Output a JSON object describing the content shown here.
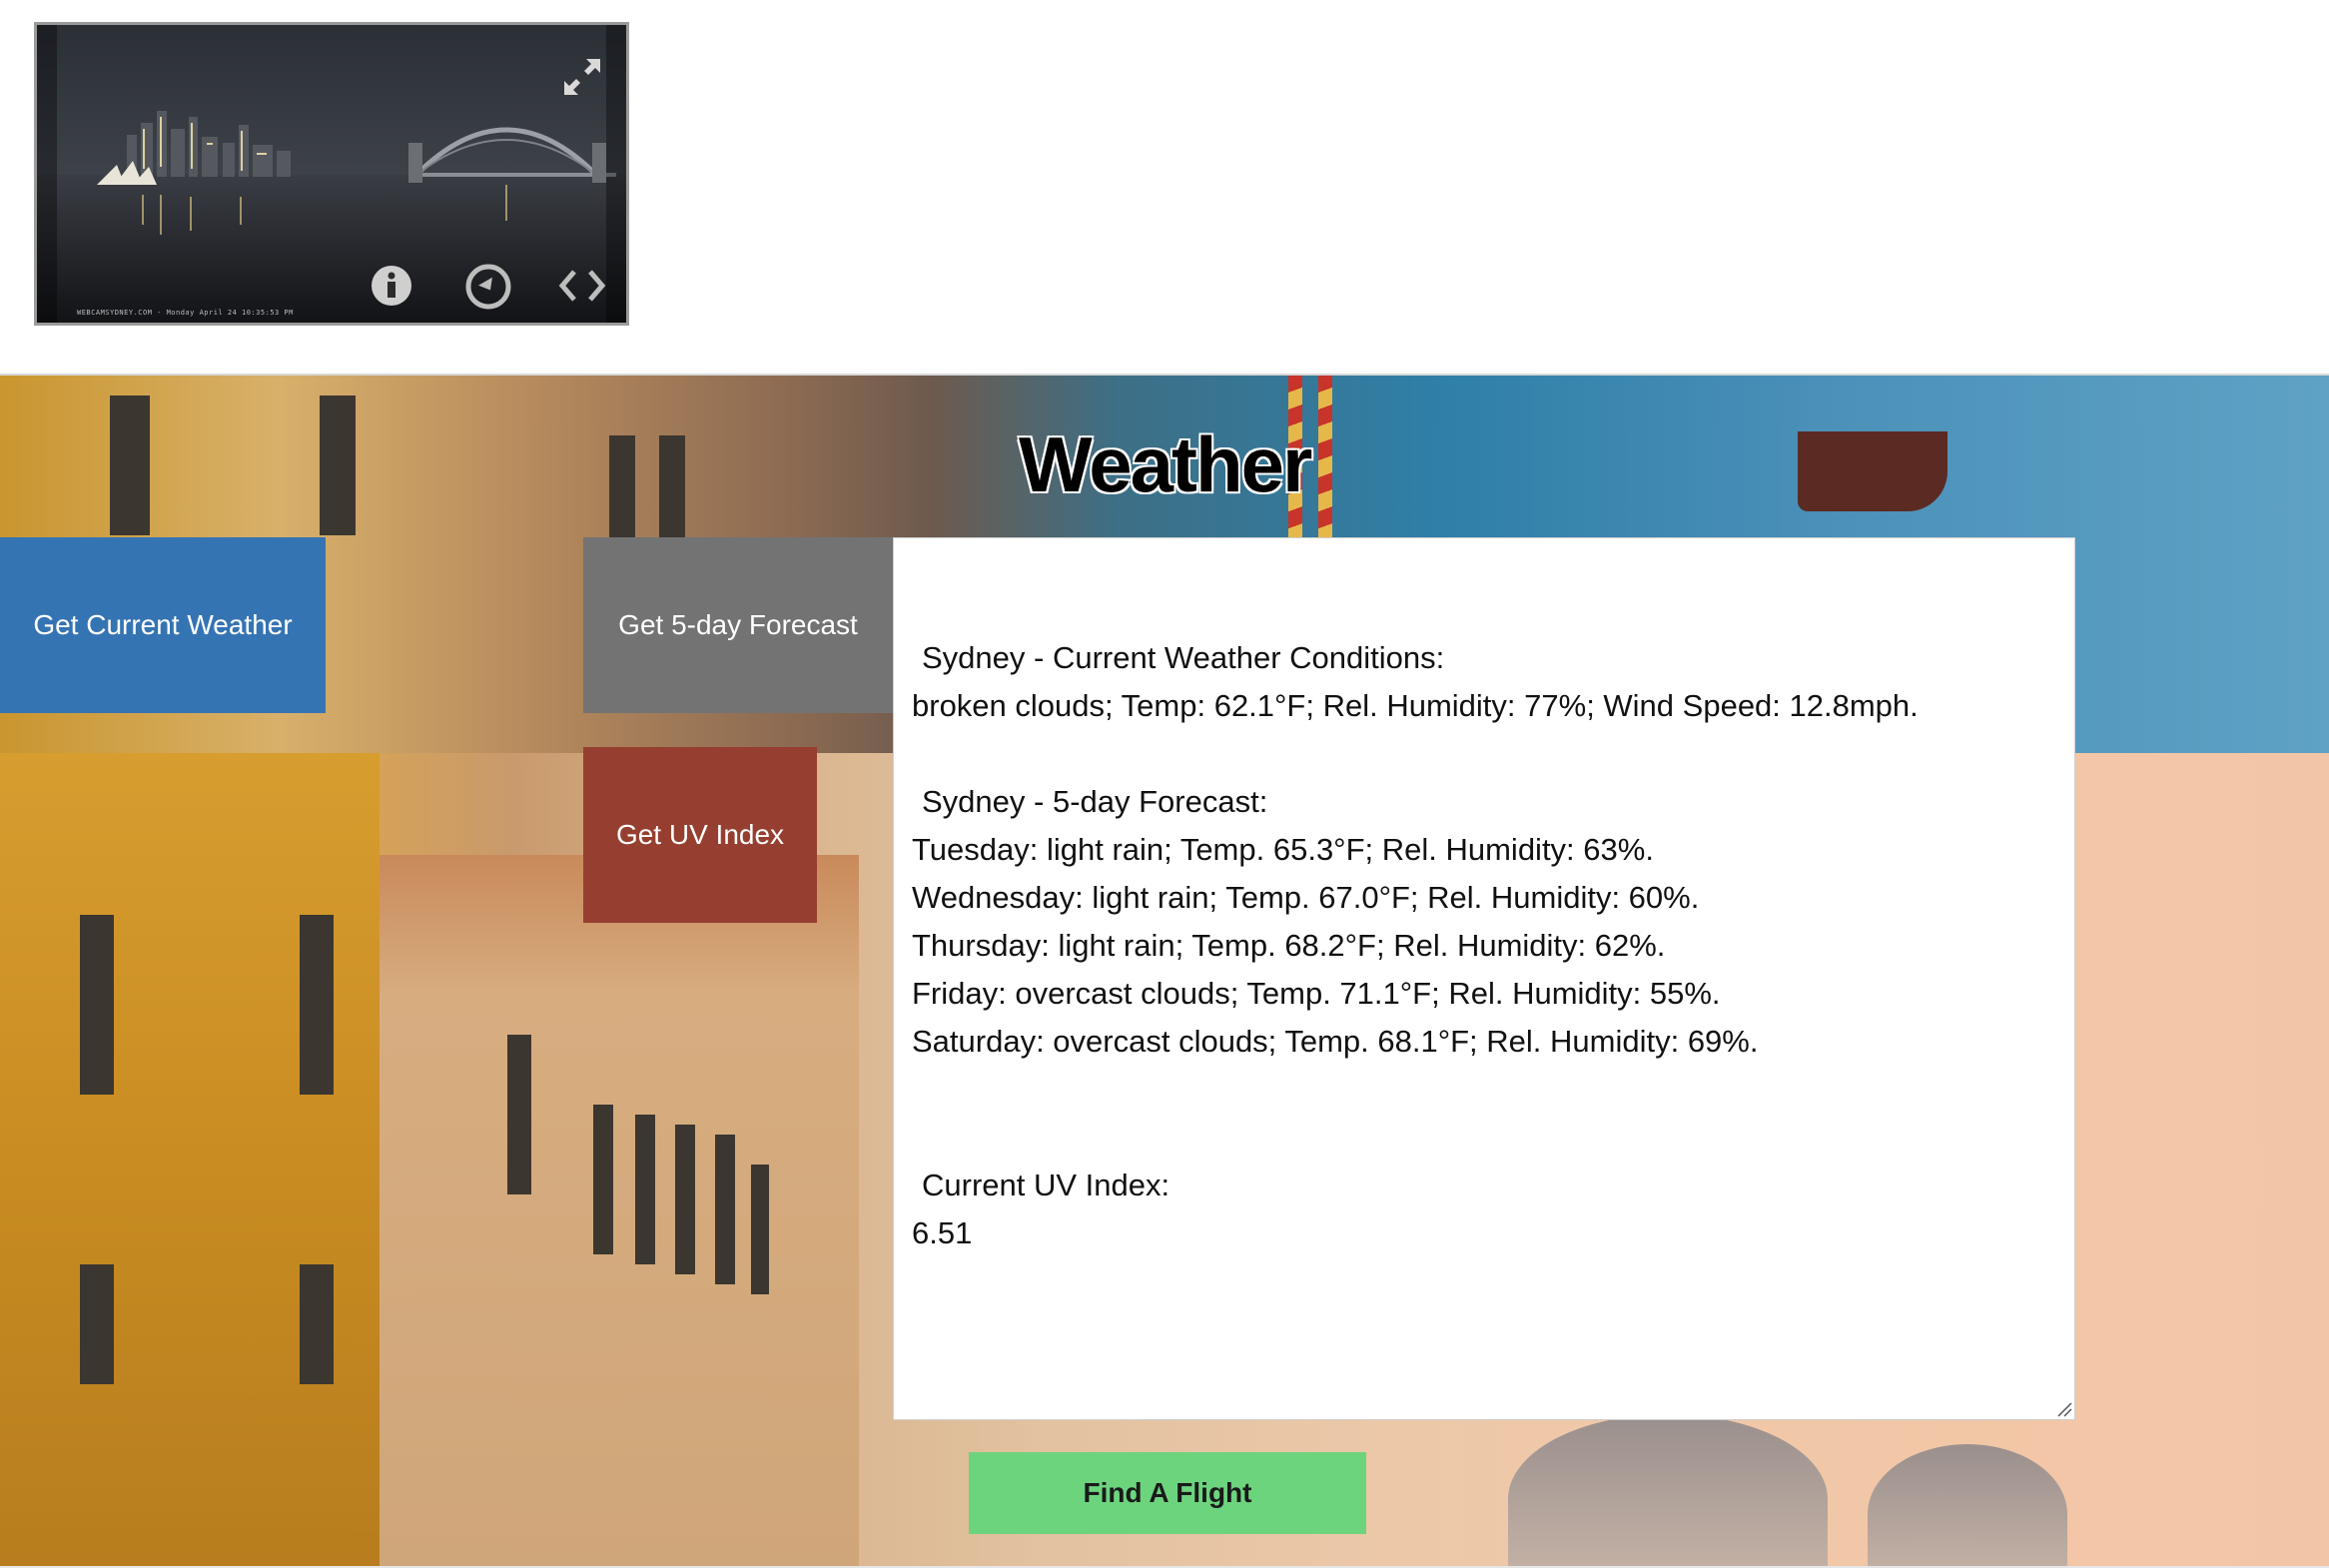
{
  "webcam": {
    "stamp": "WEBCAMSYDNEY.COM  -  Monday April 24  10:35:53 PM",
    "icons": {
      "expand": "expand-arrows-icon",
      "info": "info-icon",
      "replay": "replay-icon",
      "embed": "embed-code-icon"
    }
  },
  "page": {
    "title": "Weather"
  },
  "buttons": {
    "current_weather": "Get Current Weather",
    "forecast": "Get 5-day Forecast",
    "uv_index": "Get UV Index",
    "find_flight": "Find A Flight"
  },
  "results": {
    "current_heading": "Sydney - Current Weather Conditions:",
    "current_text": "broken clouds; Temp: 62.1°F; Rel. Humidity: 77%; Wind Speed: 12.8mph.",
    "forecast_heading": "Sydney - 5-day Forecast:",
    "forecast_days": [
      "Tuesday: light rain; Temp. 65.3°F; Rel. Humidity: 63%.",
      "Wednesday: light rain; Temp. 67.0°F; Rel. Humidity: 60%.",
      "Thursday: light rain; Temp. 68.2°F; Rel. Humidity: 62%.",
      "Friday: overcast clouds; Temp. 71.1°F; Rel. Humidity: 55%.",
      "Saturday: overcast clouds; Temp. 68.1°F; Rel. Humidity: 69%."
    ],
    "uv_heading": "Current UV Index:",
    "uv_value": "6.51"
  },
  "colors": {
    "current_button": "#3574b3",
    "forecast_button": "#737373",
    "uv_button": "#963f30",
    "flight_button": "#6dd47e"
  }
}
